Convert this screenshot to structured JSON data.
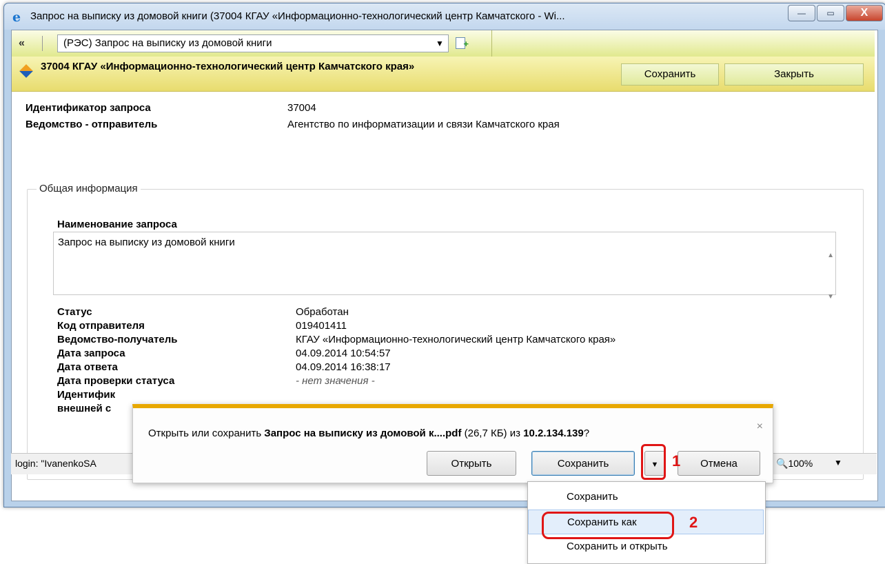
{
  "window": {
    "title": "Запрос на выписку из домовой книги (37004 КГАУ «Информационно-технологический центр Камчатского - Wi...",
    "icon": "ie-icon",
    "controls": {
      "minimize": "—",
      "maximize": "▭",
      "close": "X"
    }
  },
  "toolbar": {
    "back_label": "«",
    "selected_document": "(РЭС) Запрос на выписку из домовой книги",
    "select_arrow": "▼"
  },
  "header": {
    "org_title": "37004 КГАУ «Информационно-технологический центр Камчатского края»",
    "save_label": "Сохранить",
    "close_label": "Закрыть"
  },
  "summary": [
    {
      "label": "Идентификатор запроса",
      "value": "37004"
    },
    {
      "label": "Ведомство - отправитель",
      "value": "Агентство по информатизации и связи Камчатского края"
    }
  ],
  "general": {
    "legend": "Общая информация",
    "name_label": "Наименование запроса",
    "name_value": "Запрос на выписку из домовой книги",
    "details": [
      {
        "label": "Статус",
        "value": "Обработан"
      },
      {
        "label": "Код отправителя",
        "value": "019401411"
      },
      {
        "label": "Ведомство-получатель",
        "value": "КГАУ «Информационно-технологический центр Камчатского края»"
      },
      {
        "label": "Дата запроса",
        "value": "04.09.2014 10:54:57"
      },
      {
        "label": "Дата ответа",
        "value": "04.09.2014 16:38:17"
      },
      {
        "label": "Дата проверки статуса",
        "value": "- нет значения -"
      },
      {
        "label": "Идентифик",
        "value": ""
      },
      {
        "label": "внешней с",
        "value": ""
      }
    ]
  },
  "statusbar": {
    "text": "login: \"IvanenkoSA",
    "zoom": "100%"
  },
  "download_bar": {
    "prefix": "Открыть или сохранить ",
    "filename": "Запрос на выписку из домовой к....pdf",
    "size": " (26,7 КБ)  из ",
    "host": "10.2.134.139",
    "suffix": "?",
    "close": "×",
    "open_label": "Открыть",
    "save_label": "Сохранить",
    "cancel_label": "Отмена",
    "annotation_1": "1"
  },
  "save_menu": {
    "items": [
      "Сохранить",
      "Сохранить как",
      "Сохранить и открыть"
    ],
    "annotation_2": "2"
  },
  "colors": {
    "toolbar": "#e1e98e",
    "header_band": "#e8dc6e",
    "notify_accent": "#e8a800",
    "annotation": "#e01515"
  }
}
